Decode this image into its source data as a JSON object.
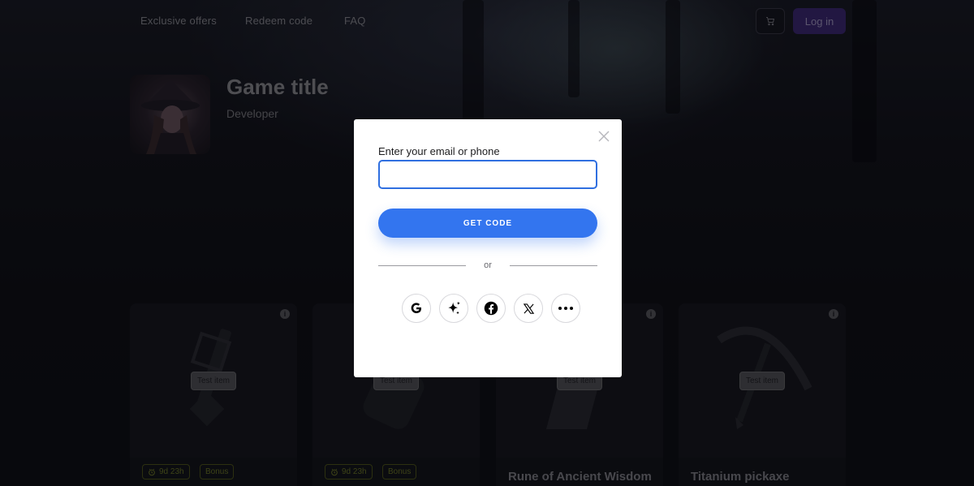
{
  "nav": {
    "links": [
      "Exclusive offers",
      "Redeem code",
      "FAQ"
    ],
    "login_label": "Log in"
  },
  "game": {
    "title": "Game title",
    "developer": "Developer"
  },
  "cards": [
    {
      "badge": "Test item",
      "tags": [
        "9d 23h",
        "Bonus"
      ],
      "name": ""
    },
    {
      "badge": "Test item",
      "tags": [
        "9d 23h",
        "Bonus"
      ],
      "name": ""
    },
    {
      "badge": "Test item",
      "tags": [],
      "name": "Rune of Ancient Wisdom"
    },
    {
      "badge": "Test item",
      "tags": [],
      "name": "Titanium pickaxe"
    }
  ],
  "modal": {
    "field_label": "Enter your email or phone",
    "email_value": "",
    "email_placeholder": "",
    "get_code_label": "GET CODE",
    "or_text": "or",
    "social_icons": [
      "google-icon",
      "sparkle-icon",
      "facebook-icon",
      "x-icon",
      "more-icon"
    ]
  },
  "colors": {
    "primary_button": "#3375ef",
    "input_border": "#2f6fe0",
    "login_button": "#3e2a78",
    "tag_color": "#6f7a2a"
  }
}
